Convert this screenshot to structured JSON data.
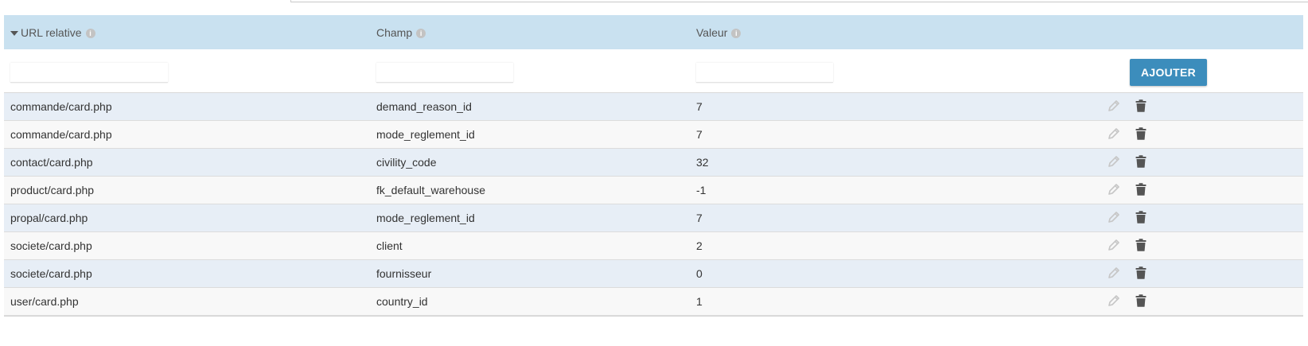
{
  "columns": {
    "url": "URL relative",
    "field": "Champ",
    "value": "Valeur"
  },
  "info_glyph": "i",
  "filters": {
    "url": "",
    "field": "",
    "value": ""
  },
  "add_label": "AJOUTER",
  "rows": [
    {
      "url": "commande/card.php",
      "field": "demand_reason_id",
      "value": "7"
    },
    {
      "url": "commande/card.php",
      "field": "mode_reglement_id",
      "value": "7"
    },
    {
      "url": "contact/card.php",
      "field": "civility_code",
      "value": "32"
    },
    {
      "url": "product/card.php",
      "field": "fk_default_warehouse",
      "value": "-1"
    },
    {
      "url": "propal/card.php",
      "field": "mode_reglement_id",
      "value": "7"
    },
    {
      "url": "societe/card.php",
      "field": "client",
      "value": "2"
    },
    {
      "url": "societe/card.php",
      "field": "fournisseur",
      "value": "0"
    },
    {
      "url": "user/card.php",
      "field": "country_id",
      "value": "1"
    }
  ],
  "icons": {
    "sort": "caret-down-icon",
    "info": "info-icon",
    "edit": "pencil-icon",
    "delete": "trash-icon"
  },
  "colors": {
    "header_bg": "#c9e1f0",
    "row_alt": "#e7eef6",
    "row": "#f8f8f8",
    "button": "#3c8dbc"
  }
}
